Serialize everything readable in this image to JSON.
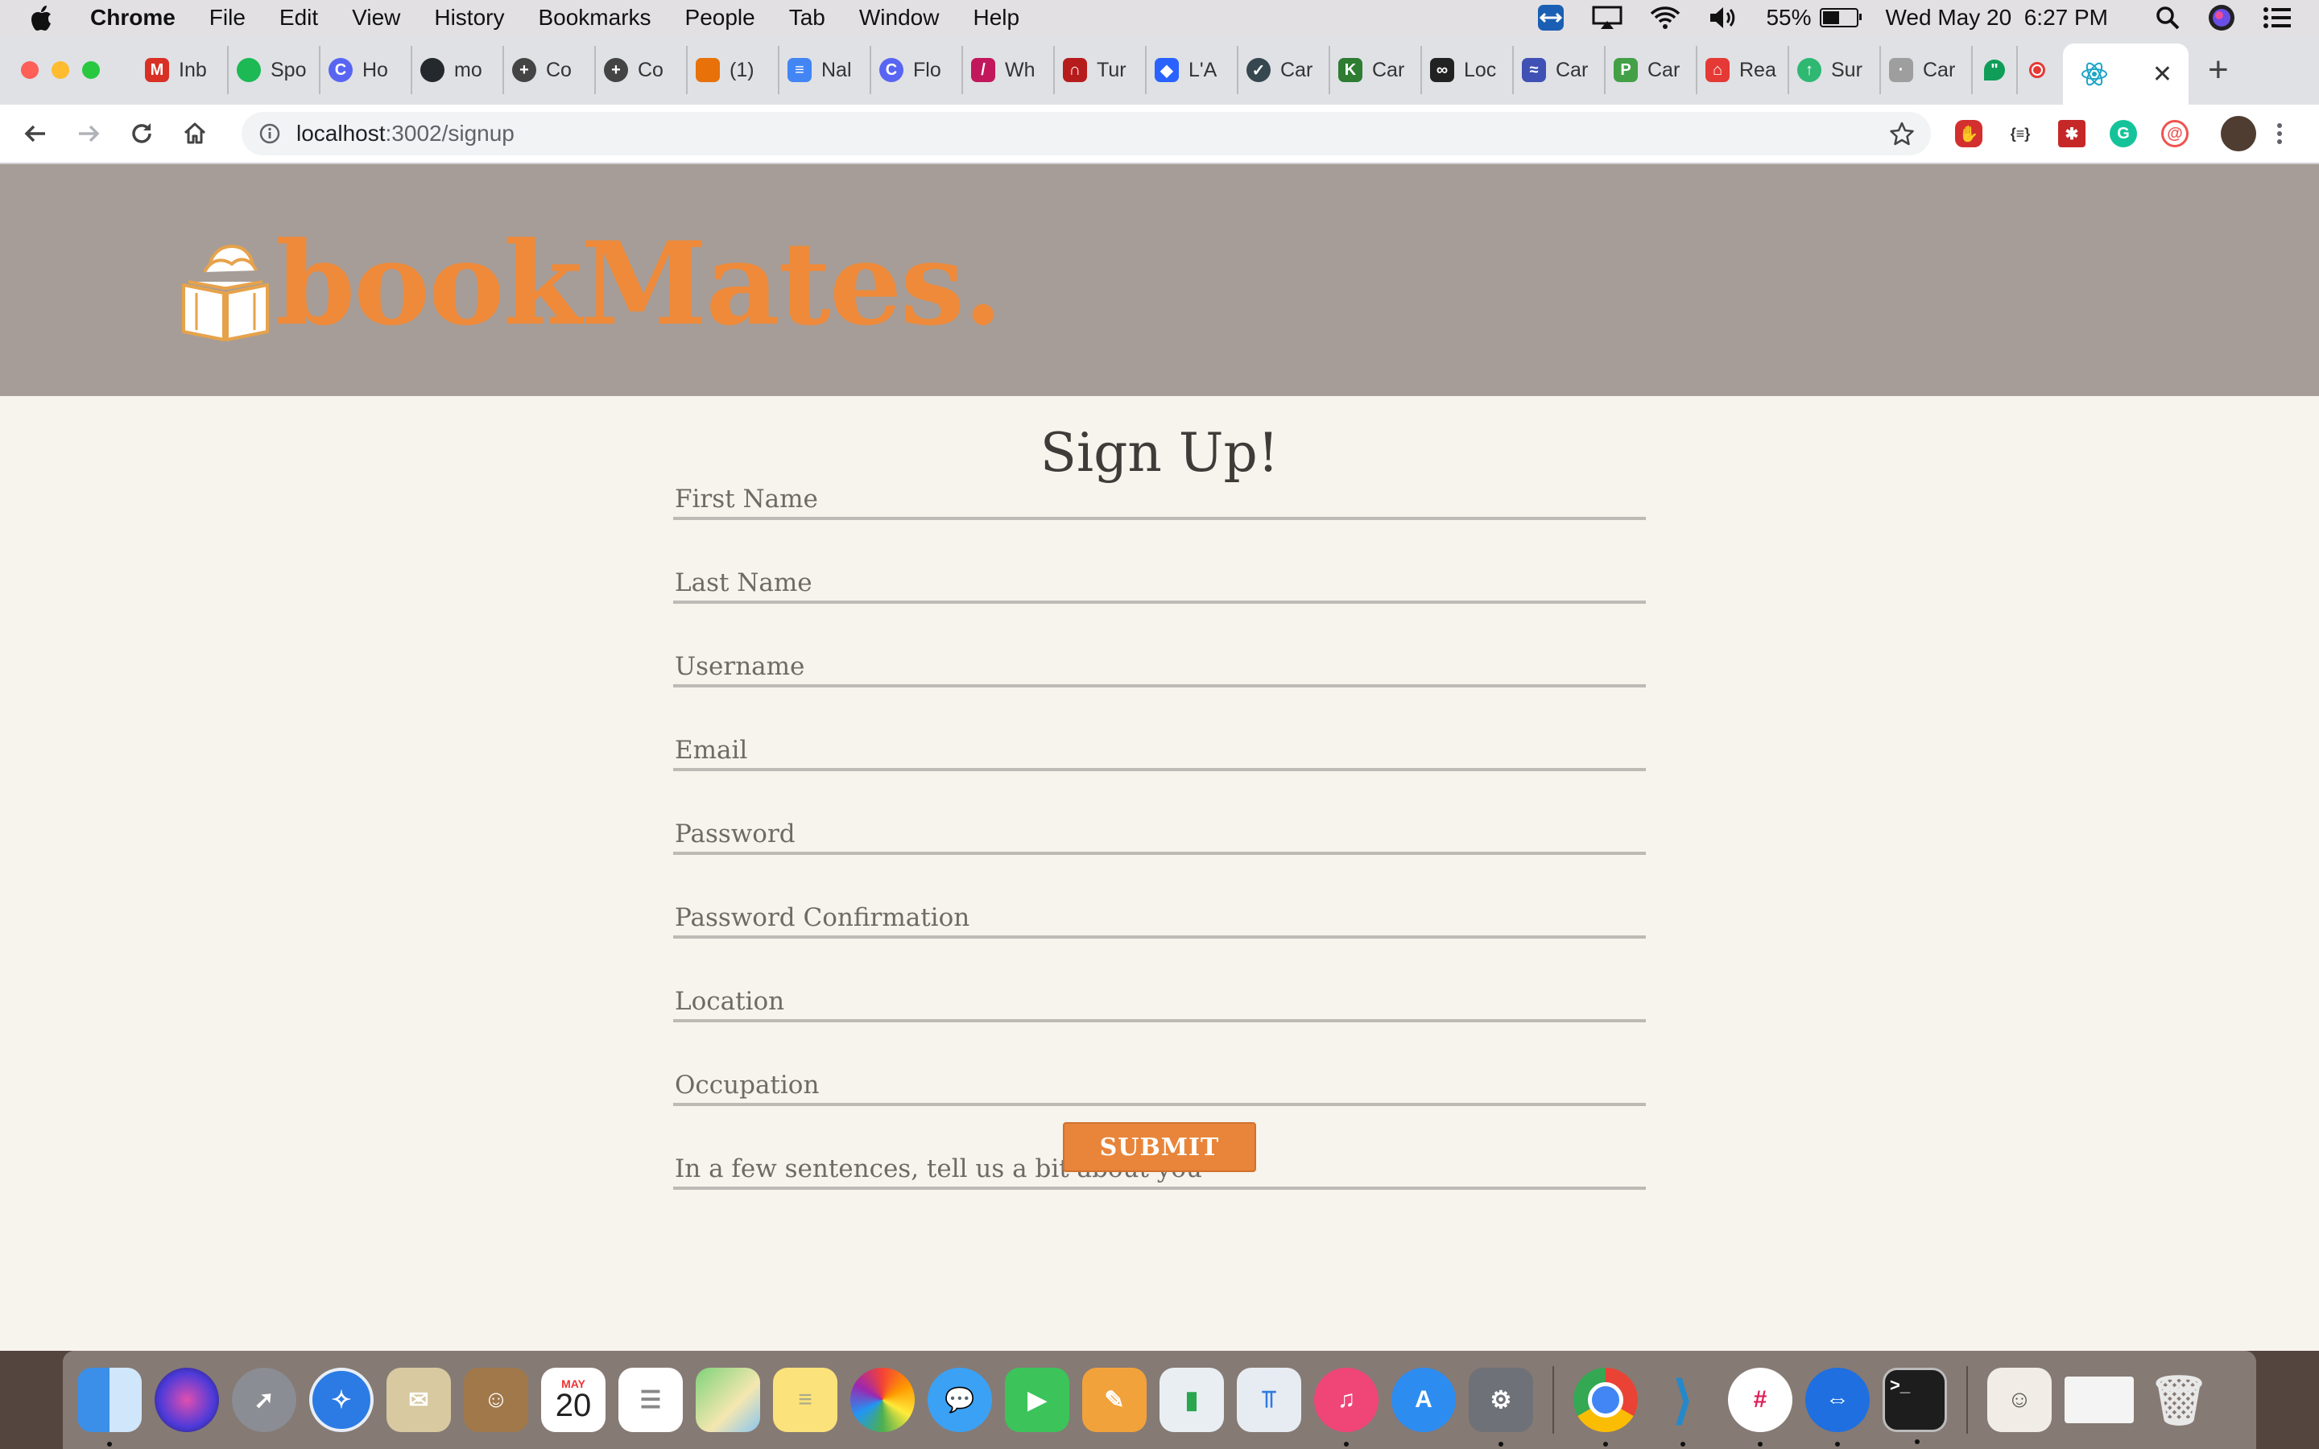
{
  "menubar": {
    "app": "Chrome",
    "items": [
      "File",
      "Edit",
      "View",
      "History",
      "Bookmarks",
      "People",
      "Tab",
      "Window",
      "Help"
    ],
    "battery": "55%",
    "battery_level": 0.55,
    "datetime": "Wed May 20  6:27 PM"
  },
  "tabs": [
    {
      "label": "Inb",
      "icon": "gmail-icon",
      "color": "#d93025",
      "glyph": "M"
    },
    {
      "label": "Spo",
      "icon": "spotify-icon",
      "color": "#1db954",
      "glyph": ""
    },
    {
      "label": "Ho",
      "icon": "c-circle-icon",
      "color": "#5865f2",
      "glyph": "C"
    },
    {
      "label": "mo",
      "icon": "github-icon",
      "color": "#24292e",
      "glyph": ""
    },
    {
      "label": "Co",
      "icon": "plus-circle-icon",
      "color": "#444444",
      "glyph": "+"
    },
    {
      "label": "Co",
      "icon": "plus-circle-icon",
      "color": "#444444",
      "glyph": "+"
    },
    {
      "label": "(1)",
      "icon": "arc-icon",
      "color": "#e8710a",
      "glyph": ""
    },
    {
      "label": "Nal",
      "icon": "docs-icon",
      "color": "#4285f4",
      "glyph": "≡"
    },
    {
      "label": "Flo",
      "icon": "c-circle-icon",
      "color": "#5865f2",
      "glyph": "C"
    },
    {
      "label": "Wh",
      "icon": "slash-icon",
      "color": "#c2185b",
      "glyph": "/"
    },
    {
      "label": "Tur",
      "icon": "magnet-icon",
      "color": "#b71c1c",
      "glyph": "∩"
    },
    {
      "label": "L'A",
      "icon": "diamond-icon",
      "color": "#2962ff",
      "glyph": "◆"
    },
    {
      "label": "Car",
      "icon": "check-circle-icon",
      "color": "#37474f",
      "glyph": "✓"
    },
    {
      "label": "Car",
      "icon": "kite-icon",
      "color": "#2e7d32",
      "glyph": "K"
    },
    {
      "label": "Loc",
      "icon": "loop-icon",
      "color": "#222222",
      "glyph": "∞"
    },
    {
      "label": "Car",
      "icon": "fish-icon",
      "color": "#3f51b5",
      "glyph": "≈"
    },
    {
      "label": "Car",
      "icon": "p-icon",
      "color": "#43a047",
      "glyph": "P"
    },
    {
      "label": "Rea",
      "icon": "house-icon",
      "color": "#e53935",
      "glyph": "⌂"
    },
    {
      "label": "Sur",
      "icon": "cloud-icon",
      "color": "#2eb872",
      "glyph": "↑"
    },
    {
      "label": "Car",
      "icon": "small-dot-icon",
      "color": "#9e9e9e",
      "glyph": "·"
    }
  ],
  "active_tab": {
    "icon": "react-icon",
    "close": "✕"
  },
  "pinned_tab_icons": [
    "hangouts-icon",
    "record-icon"
  ],
  "toolbar": {
    "url_host": "localhost",
    "url_path": ":3002/signup"
  },
  "site": {
    "logo_text": "bookMates.",
    "brand_color": "#ee8a3a",
    "header_color": "#a69d98"
  },
  "form": {
    "title": "Sign Up!",
    "fields": [
      {
        "name": "first-name-field",
        "placeholder": "First Name",
        "value": ""
      },
      {
        "name": "last-name-field",
        "placeholder": "Last Name",
        "value": ""
      },
      {
        "name": "username-field",
        "placeholder": "Username",
        "value": ""
      },
      {
        "name": "email-field",
        "placeholder": "Email",
        "value": ""
      },
      {
        "name": "password-field",
        "placeholder": "Password",
        "value": ""
      },
      {
        "name": "password-confirmation-field",
        "placeholder": "Password Confirmation",
        "value": ""
      },
      {
        "name": "location-field",
        "placeholder": "Location",
        "value": ""
      },
      {
        "name": "occupation-field",
        "placeholder": "Occupation",
        "value": ""
      },
      {
        "name": "about-field",
        "placeholder": "In a few sentences, tell us a bit about you",
        "value": ""
      }
    ],
    "submit_label": "SUBMIT",
    "submit_color": "#e8853a"
  },
  "dock": {
    "calendar_month": "MAY",
    "calendar_day": "20",
    "apps": [
      "finder-icon",
      "siri-icon",
      "launchpad-icon",
      "safari-icon",
      "mail-icon",
      "contacts-icon",
      "calendar-icon",
      "reminders-icon",
      "maps-icon",
      "notes-icon",
      "photos-icon",
      "messages-icon",
      "facetime-icon",
      "pages-icon",
      "numbers-icon",
      "keynote-icon",
      "itunes-icon",
      "app-store-icon",
      "system-preferences-icon",
      "chrome-icon",
      "vscode-icon",
      "slack-icon",
      "teamviewer-icon",
      "terminal-icon",
      "downloads-icon",
      "preview-icon",
      "trash-icon"
    ]
  }
}
